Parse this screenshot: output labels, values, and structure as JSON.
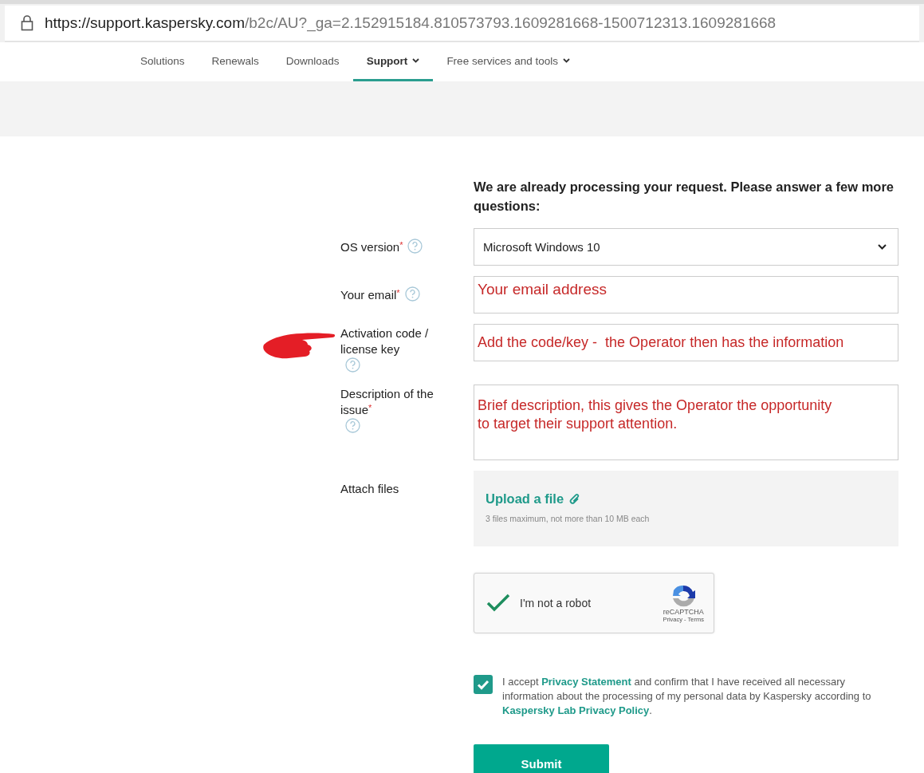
{
  "address_bar": {
    "url_host": "https://support.kaspersky.com",
    "url_path": "/b2c/AU?_ga=2.152915184.810573793.1609281668-1500712313.1609281668"
  },
  "nav": {
    "items": [
      {
        "label": "Solutions",
        "selected": false,
        "dropdown": false
      },
      {
        "label": "Renewals",
        "selected": false,
        "dropdown": false
      },
      {
        "label": "Downloads",
        "selected": false,
        "dropdown": false
      },
      {
        "label": "Support",
        "selected": true,
        "dropdown": true
      },
      {
        "label": "Free services and tools",
        "selected": false,
        "dropdown": true
      }
    ]
  },
  "form": {
    "heading": "We are already processing your request. Please answer a few more questions:",
    "fields": [
      {
        "kind": "select",
        "label": "OS version$^{*}$",
        "help": true,
        "value": "Microsoft Windows 10"
      },
      {
        "kind": "text",
        "label": "Your email$^{*}$",
        "help": true,
        "value": "Your email address"
      },
      {
        "kind": "text",
        "label": "Activation code / license key",
        "help": true,
        "value": "Add the code/key -  the Operator then has the information",
        "pointer": true
      },
      {
        "kind": "textarea",
        "label": "Description of the issue$^{*}$",
        "help": true,
        "value": "Brief description, this gives the Operator the opportunity\nto target their support attention."
      },
      {
        "kind": "upload",
        "label": "Attach files",
        "help": false,
        "link": "Upload a file",
        "hint": "3 files maximum, not more than 10 MB each"
      }
    ],
    "captcha": {
      "label": "I'm not a robot",
      "checked": true,
      "brand": "reCAPTCHA",
      "links": "Privacy - Terms"
    },
    "consent": {
      "checked": true,
      "segments": [
        {
          "kind": "text",
          "text": "I accept "
        },
        {
          "kind": "link",
          "text": "Privacy Statement"
        },
        {
          "kind": "text",
          "text": " and confirm that I have received all necessary information about the processing of my personal data by Kaspersky according to "
        },
        {
          "kind": "link",
          "text": "Kaspersky Lab Privacy Policy"
        },
        {
          "kind": "text",
          "text": "."
        }
      ]
    },
    "submit": "Submit"
  }
}
